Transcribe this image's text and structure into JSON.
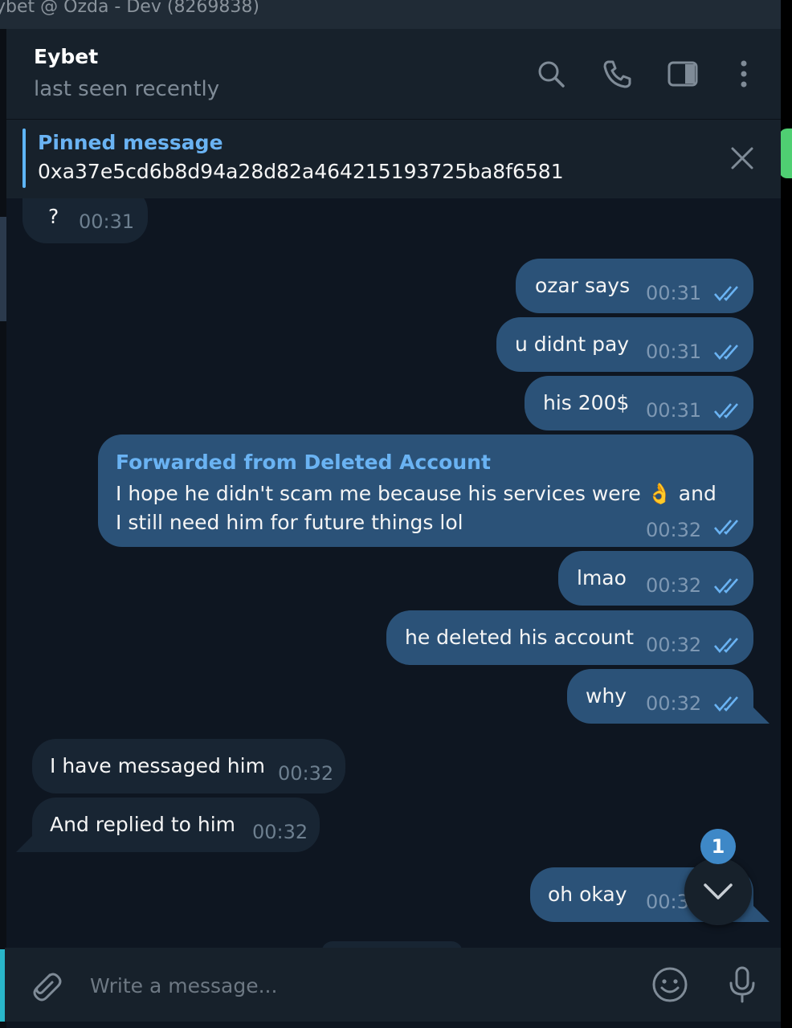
{
  "window": {
    "title": "ybet @ Ozda - Dev (8269838)"
  },
  "header": {
    "name": "Eybet",
    "status": "last seen recently"
  },
  "pinned": {
    "title": "Pinned message",
    "text": "0xa37e5cd6b8d94a28d82a464215193725ba8f6581"
  },
  "messages": [
    {
      "dir": "in",
      "text": "?",
      "time": "00:31"
    },
    {
      "dir": "out",
      "text": "ozar says",
      "time": "00:31"
    },
    {
      "dir": "out",
      "text": "u didnt pay",
      "time": "00:31"
    },
    {
      "dir": "out",
      "text": "his 200$",
      "time": "00:31"
    },
    {
      "dir": "out",
      "forwarded_from": "Forwarded from Deleted Account",
      "text": "I hope he didn't scam me because his services were 👌 and I still need him for future things lol",
      "time": "00:32"
    },
    {
      "dir": "out",
      "text": "lmao",
      "time": "00:32"
    },
    {
      "dir": "out",
      "text": "he deleted his account",
      "time": "00:32"
    },
    {
      "dir": "out",
      "text": "why",
      "time": "00:32"
    },
    {
      "dir": "in",
      "text": "I have messaged him",
      "time": "00:32"
    },
    {
      "dir": "in",
      "text": "And replied to him",
      "time": "00:32"
    },
    {
      "dir": "out",
      "text": "oh okay",
      "time": "00:3"
    }
  ],
  "scroll_button": {
    "unread_count": "1"
  },
  "composer": {
    "placeholder": "Write a message..."
  },
  "colors": {
    "background": "#0e1621",
    "header": "#17212b",
    "outgoing_bubble": "#2b5278",
    "incoming_bubble": "#182533",
    "accent": "#6ab3f3",
    "badge": "#3e88c7"
  },
  "icons": [
    "search-icon",
    "phone-icon",
    "sidebar-toggle-icon",
    "more-icon",
    "close-icon",
    "double-check-icon",
    "chevron-down-icon",
    "attach-icon",
    "emoji-icon",
    "microphone-icon"
  ]
}
